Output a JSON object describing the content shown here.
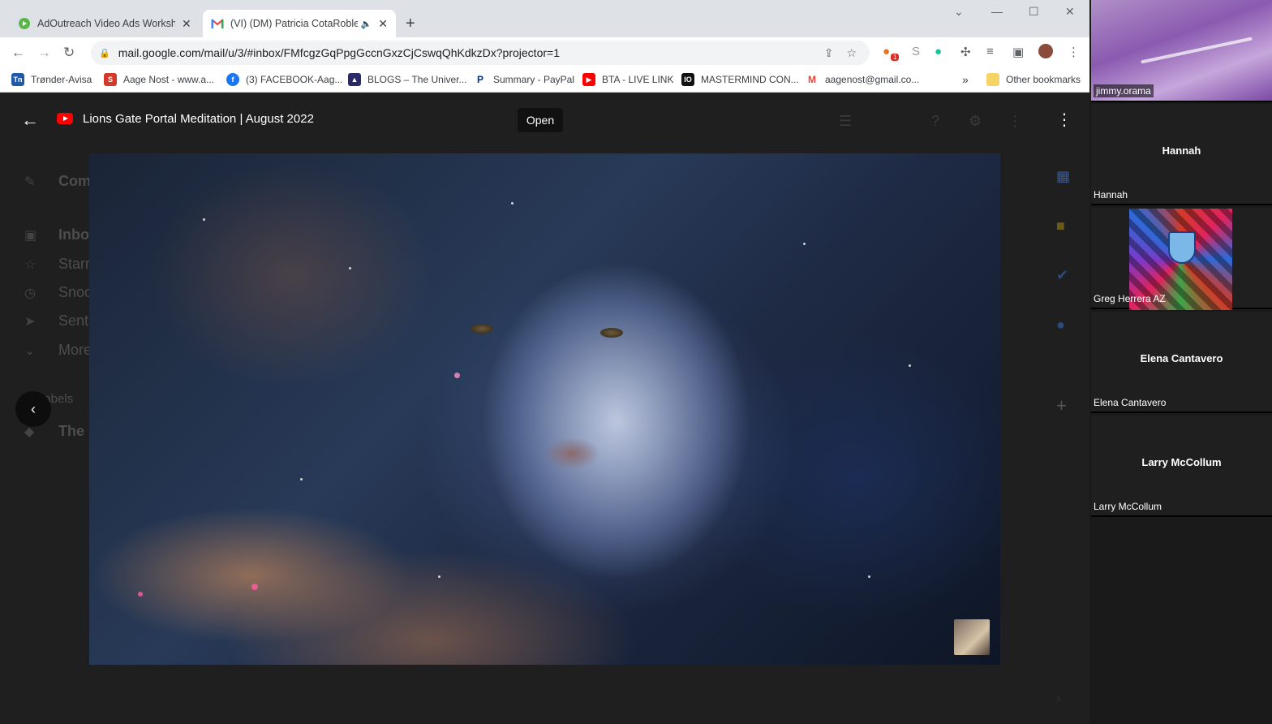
{
  "browser": {
    "tabs": [
      {
        "title": "AdOutreach Video Ads Worksho",
        "active": false,
        "favicon": "green-play-icon"
      },
      {
        "title": "(VI) (DM) Patricia CotaRoble",
        "active": true,
        "favicon": "gmail-icon"
      }
    ],
    "url": "mail.google.com/mail/u/3/#inbox/FMfcgzGqPpgGccnGxzCjCswqQhKdkzDx?projector=1",
    "bookmarks": [
      {
        "label": "Trønder-Avisa",
        "icon": "Tn",
        "color": "#1e5aa8"
      },
      {
        "label": "Aage Nost - www.a...",
        "icon": "S",
        "color": "#d23b2a"
      },
      {
        "label": "(3) FACEBOOK-Aag...",
        "icon": "f",
        "color": "#1877f2"
      },
      {
        "label": "BLOGS – The Univer...",
        "icon": "▲",
        "color": "#2a2a6a"
      },
      {
        "label": "Summary - PayPal",
        "icon": "P",
        "color": "#003087"
      },
      {
        "label": "BTA - LIVE LINK",
        "icon": "▶",
        "color": "#ff0000"
      },
      {
        "label": "MASTERMIND CON...",
        "icon": "IO",
        "color": "#111111"
      },
      {
        "label": "aagenost@gmail.co...",
        "icon": "M",
        "color": "#ea4335"
      }
    ],
    "bookmarks_more": "»",
    "other_bookmarks": "Other bookmarks",
    "extension_badge": "1"
  },
  "viewer": {
    "title": "Lions Gate Portal Meditation | August 2022",
    "open_label": "Open"
  },
  "gmail_background": {
    "items": [
      "Com",
      "Inbo",
      "Starr",
      "Snoo",
      "Sent",
      "More",
      "Labels",
      "The"
    ]
  },
  "participants": [
    {
      "name": "jimmy.orama",
      "type": "camera"
    },
    {
      "name": "Hannah",
      "display": "Hannah",
      "type": "name"
    },
    {
      "name": "Greg Herrera AZ",
      "type": "avatar"
    },
    {
      "name": "Elena Cantavero",
      "display": "Elena Cantavero",
      "type": "name"
    },
    {
      "name": "Larry McCollum",
      "display": "Larry McCollum",
      "type": "name"
    }
  ]
}
